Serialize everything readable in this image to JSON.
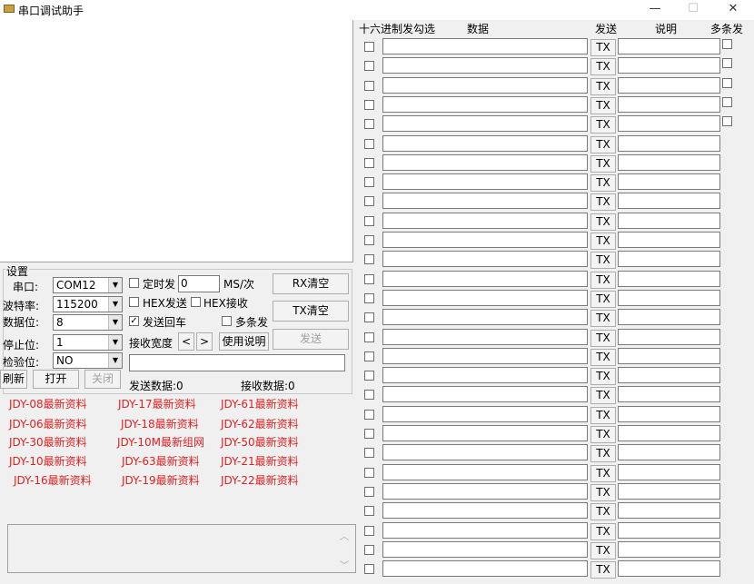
{
  "window": {
    "title": "串口调试助手",
    "minimize": "—",
    "maximize": "☐",
    "close": "✕"
  },
  "settings": {
    "group_title": "设置",
    "port_label": "串口:",
    "port_value": "COM12",
    "baud_label": "波特率:",
    "baud_value": "115200",
    "databits_label": "数据位:",
    "databits_value": "8",
    "stopbits_label": "停止位:",
    "stopbits_value": "1",
    "parity_label": "检验位:",
    "parity_value": "NO",
    "timer_send_label": "定时发",
    "timer_value": "0",
    "timer_unit": "MS/次",
    "hex_send_label": "HEX发送",
    "hex_recv_label": "HEX接收",
    "send_newline_label": "发送回车",
    "send_newline_checked": "✓",
    "multi_send_label": "多条发",
    "recv_width_label": "接收宽度",
    "width_left": "<",
    "width_right": ">",
    "usage_button": "使用说明",
    "rx_clear_button": "RX清空",
    "tx_clear_button": "TX清空",
    "send_button": "发送",
    "refresh_button": "刷新",
    "open_button": "打开",
    "close_button": "关闭",
    "sent_count_label": "发送数据:0",
    "recv_count_label": "接收数据:0"
  },
  "links": [
    [
      "JDY-08最新资料",
      "JDY-17最新资料",
      "JDY-61最新资料"
    ],
    [
      "JDY-06最新资料",
      "JDY-18最新资料",
      "JDY-62最新资料"
    ],
    [
      "JDY-30最新资料",
      "JDY-10M最新组网",
      "JDY-50最新资料"
    ],
    [
      "JDY-10最新资料",
      "JDY-63最新资料",
      "JDY-21最新资料"
    ],
    [
      "JDY-16最新资料",
      "JDY-19最新资料",
      "JDY-22最新资料"
    ]
  ],
  "multi_panel": {
    "header_hex": "十六进制发勾选",
    "header_data": "数据",
    "header_send": "发送",
    "header_desc": "说明",
    "header_multi": "多条发",
    "tx_label": "TX",
    "row_count": 28,
    "rows_with_multi_checkbox": 5
  },
  "colors": {
    "link": "#e02020",
    "background": "#f0f0f0"
  }
}
